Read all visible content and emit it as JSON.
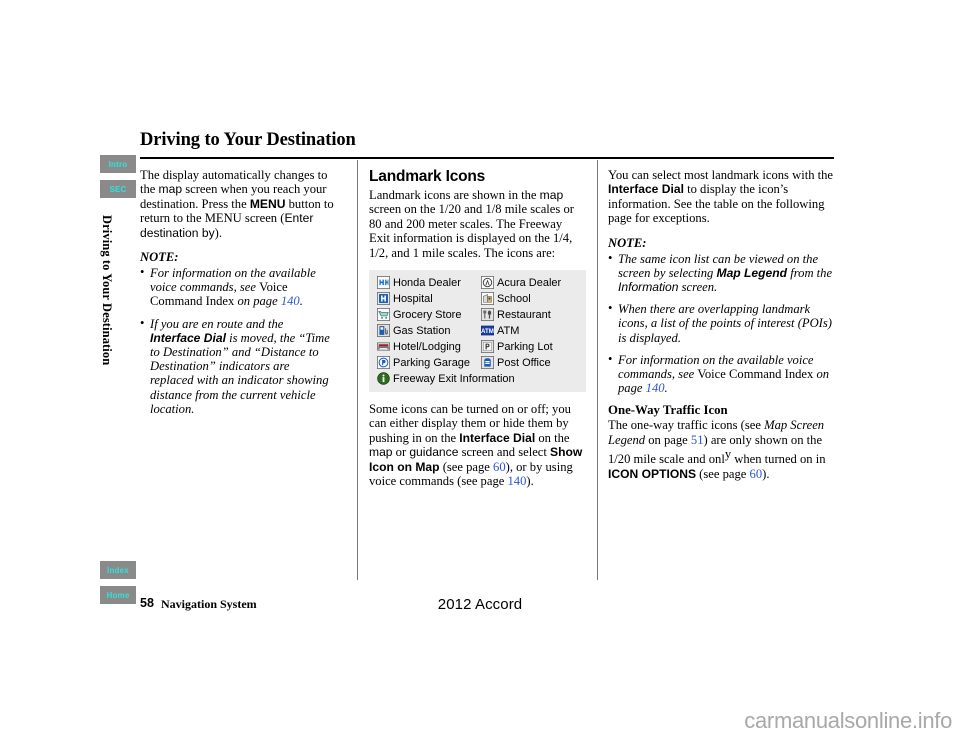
{
  "header": {
    "title": "Driving to Your Destination"
  },
  "sidebar": {
    "vertical_title": "Driving to Your Destination",
    "tabs_top": [
      {
        "label": "Intro",
        "name": "intro"
      },
      {
        "label": "SEC",
        "name": "sec"
      }
    ],
    "tabs_bottom": [
      {
        "label": "Index",
        "name": "index"
      },
      {
        "label": "Home",
        "name": "home"
      }
    ],
    "tab_colors": {
      "background": "#8a8a8a",
      "text": "#2fe3dc"
    }
  },
  "column1": {
    "intro_p1_a": "The display automatically changes to the ",
    "intro_map": "map",
    "intro_p1_b": " screen when you reach your destination. Press the ",
    "intro_menu": "MENU",
    "intro_p1_c": " button to return to the MENU screen (",
    "intro_enter": "Enter destination by",
    "intro_p1_d": ").",
    "note_heading": "NOTE:",
    "note_items": [
      {
        "a": "For information on the available voice commands, see ",
        "b": "Voice Command Index",
        "c": " on page ",
        "page": "140",
        "d": "."
      },
      {
        "a": "If you are en route and the ",
        "b": "Interface Dial",
        "c": " is moved, the “Time to Destination” and “Distance to Destination” indicators are replaced with an indicator showing distance from the current vehicle location."
      }
    ]
  },
  "column2": {
    "section_title": "Landmark Icons",
    "p1_a": "Landmark icons are shown in the ",
    "p1_map": "map",
    "p1_b": " screen on the 1/20 and 1/8 mile scales or 80 and 200 meter scales. The Freeway Exit information is displayed on the 1/4, 1/2, and 1 mile scales. The icons are:",
    "legend": {
      "background": "#ebebeb",
      "rows": [
        {
          "left": {
            "icon": "honda-dealer-icon",
            "label": "Honda Dealer"
          },
          "right": {
            "icon": "acura-dealer-icon",
            "label": "Acura Dealer"
          }
        },
        {
          "left": {
            "icon": "hospital-icon",
            "label": "Hospital"
          },
          "right": {
            "icon": "school-icon",
            "label": "School"
          }
        },
        {
          "left": {
            "icon": "grocery-store-icon",
            "label": "Grocery Store"
          },
          "right": {
            "icon": "restaurant-icon",
            "label": "Restaurant"
          }
        },
        {
          "left": {
            "icon": "gas-station-icon",
            "label": "Gas Station"
          },
          "right": {
            "icon": "atm-icon",
            "label": "ATM"
          }
        },
        {
          "left": {
            "icon": "hotel-lodging-icon",
            "label": "Hotel/Lodging"
          },
          "right": {
            "icon": "parking-lot-icon",
            "label": "Parking Lot"
          }
        },
        {
          "left": {
            "icon": "parking-garage-icon",
            "label": "Parking Garage"
          },
          "right": {
            "icon": "post-office-icon",
            "label": "Post Office"
          }
        },
        {
          "left": {
            "icon": "freeway-exit-information-icon",
            "label": "Freeway Exit Information"
          },
          "right": null
        }
      ]
    },
    "p2_a": "Some icons can be turned on or off; you can either display them or hide them by pushing in on the ",
    "p2_dial": "Interface Dial",
    "p2_b": " on the ",
    "p2_map": "map",
    "p2_c": " or ",
    "p2_guidance": "guidance",
    "p2_d": " screen and select ",
    "p2_show": "Show Icon on Map",
    "p2_e": " (see page ",
    "p2_page1": "60",
    "p2_f": "), or by using voice commands (see page ",
    "p2_page2": "140",
    "p2_g": ")."
  },
  "column3": {
    "p1_a": "You can select most landmark icons with the ",
    "p1_dial": "Interface Dial",
    "p1_b": " to display the icon’s information. See the table on the following page for exceptions.",
    "note_heading": "NOTE:",
    "note_items": [
      {
        "a": "The same icon list can be viewed on the screen by selecting ",
        "b": "Map Legend",
        "c": " from the ",
        "d": "Information",
        "e": " screen."
      },
      {
        "a": "When there are overlapping landmark icons, a list of the points of interest (POIs) is displayed."
      },
      {
        "a": "For information on the available voice commands, see ",
        "b": "Voice Command Index",
        "c": " on page ",
        "page": "140",
        "d": "."
      }
    ],
    "subsection_title": "One-Way Traffic Icon",
    "p2_a": "The one-way traffic icons (see ",
    "p2_legend": "Map Screen Legend",
    "p2_b": " on page ",
    "p2_page1": "51",
    "p2_c": ") are only shown on the 1/20 mile scale and onl",
    "p2_sup": "y",
    "p2_d": " when turned on in ",
    "p2_iconopts": "ICON OPTIONS",
    "p2_e": " (see page ",
    "p2_page2": "60",
    "p2_f": ")."
  },
  "footer": {
    "page_number": "58",
    "manual_name": "Navigation System",
    "model": "2012 Accord",
    "watermark": "carmanualsonline.info"
  },
  "colors": {
    "link_blue": "#2a57d6",
    "legend_bg": "#ebebeb",
    "tab_gray": "#8a8a8a",
    "tab_cyan": "#2fe3dc",
    "watermark_gray": "#a8a8a8"
  }
}
